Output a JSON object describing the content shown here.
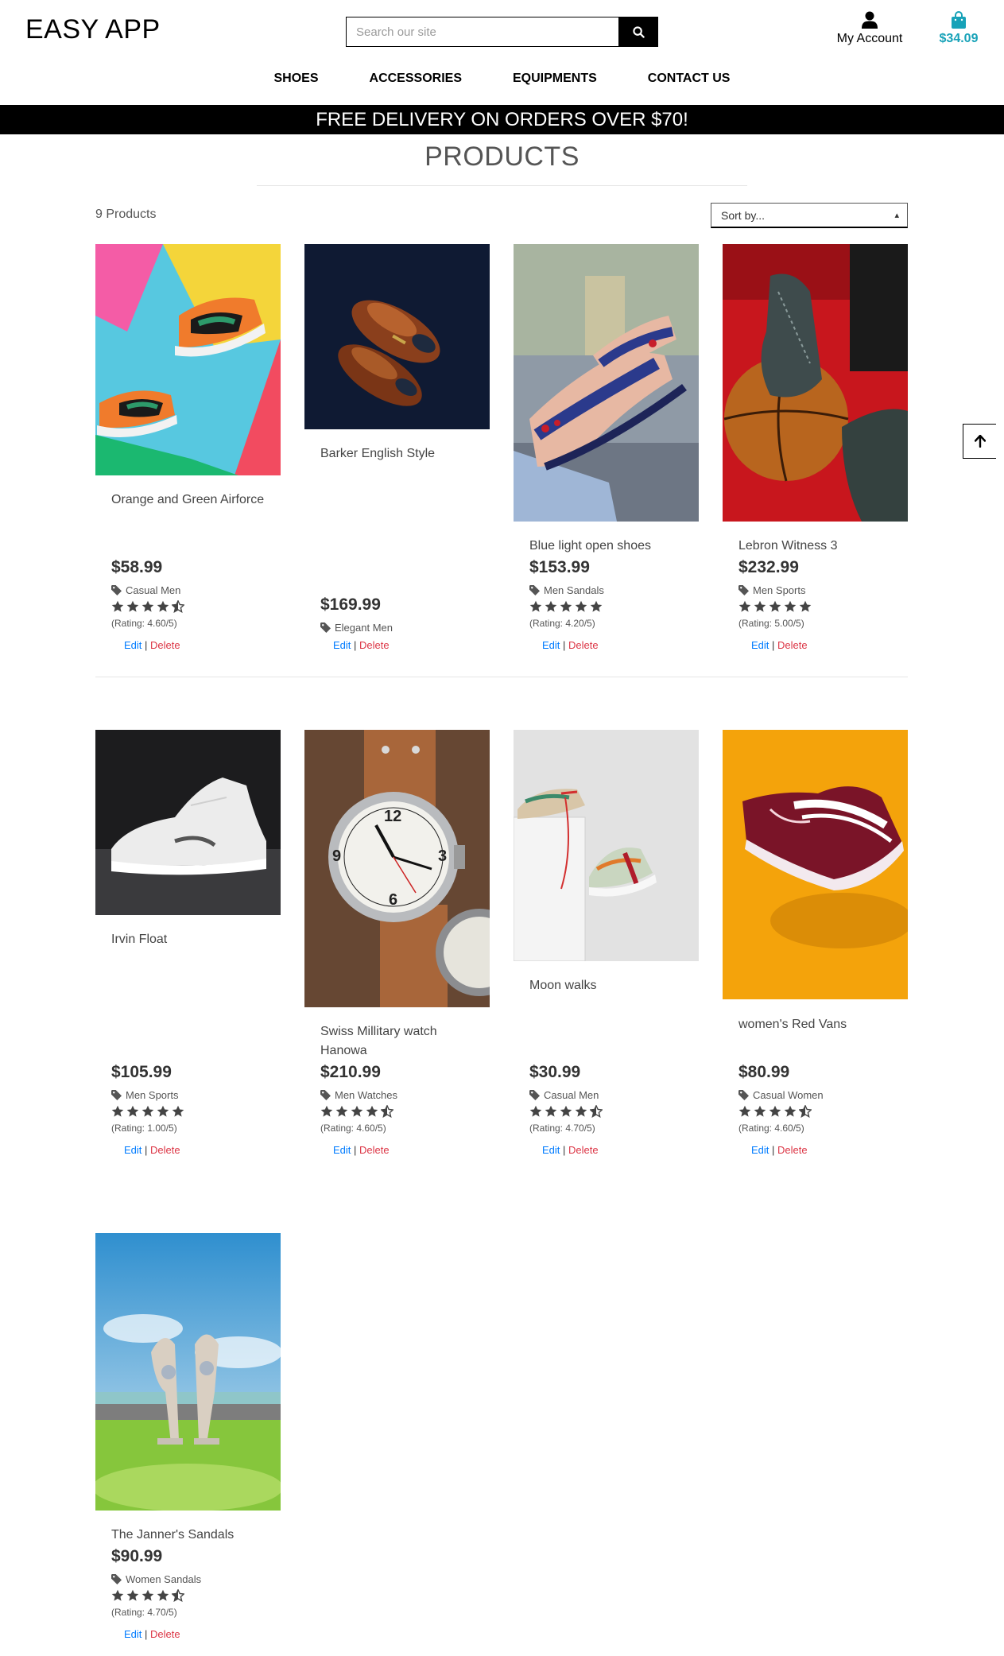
{
  "header": {
    "logo": "EASY APP",
    "search_placeholder": "Search our site",
    "account_label": "My Account",
    "bag_total": "$34.09"
  },
  "nav": [
    "SHOES",
    "ACCESSORIES",
    "EQUIPMENTS",
    "CONTACT US"
  ],
  "banner": "FREE DELIVERY ON ORDERS OVER $70!",
  "page_title": "PRODUCTS",
  "product_count": "9 Products",
  "sort_label": "Sort by...",
  "actions": {
    "edit": "Edit",
    "separator": "|",
    "delete": "Delete"
  },
  "colors": {
    "accent": "#17a2b8",
    "edit": "#007bff",
    "delete": "#dc3545"
  },
  "products": [
    {
      "name": "Orange and Green Airforce",
      "price": "$58.99",
      "category": "Casual Men",
      "rating": "(Rating: 4.60/5)",
      "stars": 4.5
    },
    {
      "name": "Barker English Style",
      "price": "$169.99",
      "category": "Elegant Men",
      "rating": "",
      "stars": 0
    },
    {
      "name": "Blue light open shoes",
      "price": "$153.99",
      "category": "Men Sandals",
      "rating": "(Rating: 4.20/5)",
      "stars": 5
    },
    {
      "name": "Lebron Witness 3",
      "price": "$232.99",
      "category": "Men Sports",
      "rating": "(Rating: 5.00/5)",
      "stars": 5
    },
    {
      "name": "Irvin Float",
      "price": "$105.99",
      "category": "Men Sports",
      "rating": "(Rating: 1.00/5)",
      "stars": 5
    },
    {
      "name": "Swiss Millitary watch Hanowa",
      "price": "$210.99",
      "category": "Men Watches",
      "rating": "(Rating: 4.60/5)",
      "stars": 4.5
    },
    {
      "name": "Moon walks",
      "price": "$30.99",
      "category": "Casual Men",
      "rating": "(Rating: 4.70/5)",
      "stars": 4.5
    },
    {
      "name": "women's Red Vans",
      "price": "$80.99",
      "category": "Casual Women",
      "rating": "(Rating: 4.60/5)",
      "stars": 4.5
    },
    {
      "name": "The Janner's Sandals",
      "price": "$90.99",
      "category": "Women Sandals",
      "rating": "(Rating: 4.70/5)",
      "stars": 4.5
    }
  ]
}
